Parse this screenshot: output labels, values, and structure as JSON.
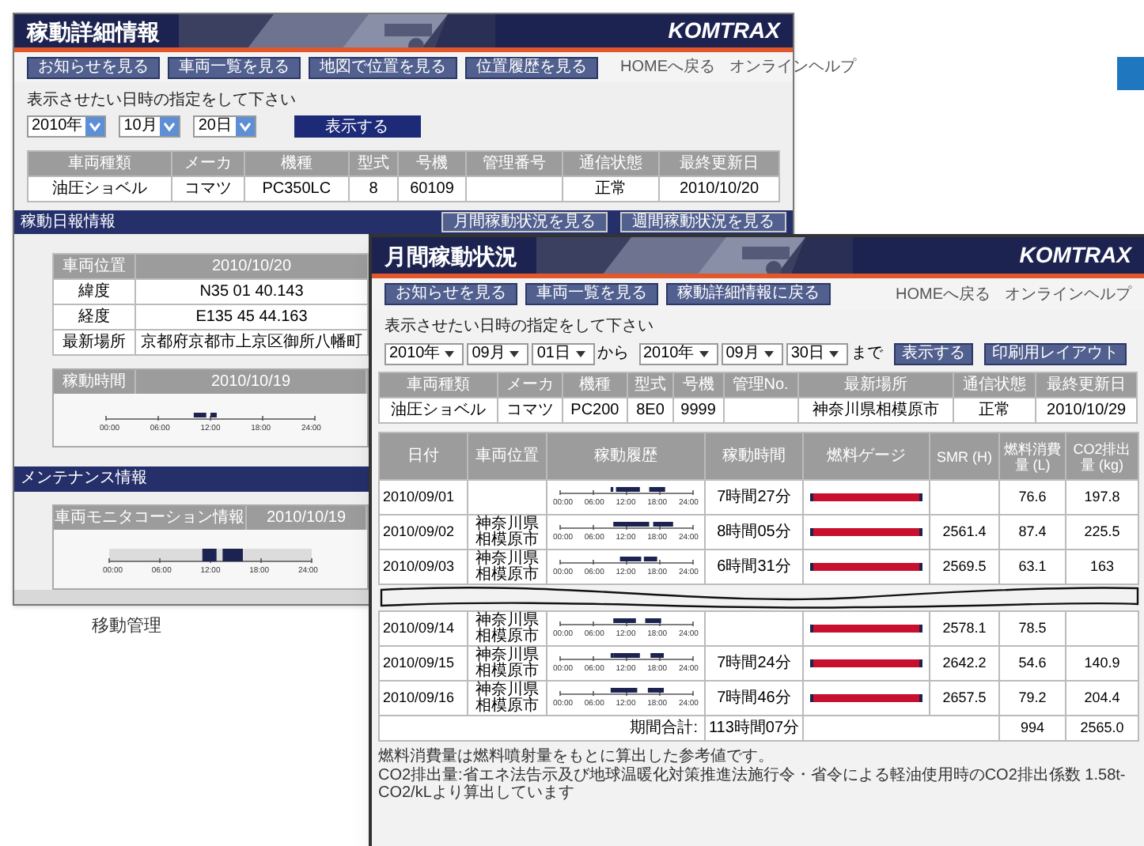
{
  "caption": "移動管理",
  "detail_window": {
    "title": "稼動詳細情報",
    "logo": "KOMTRAX",
    "nav_buttons": [
      "お知らせを見る",
      "車両一覧を見る",
      "地図で位置を見る",
      "位置履歴を見る"
    ],
    "links": [
      "HOMEへ戻る",
      "オンラインヘルプ"
    ],
    "date_prompt": "表示させたい日時の指定をして下さい",
    "selects": [
      "2010年",
      "10月",
      "20日"
    ],
    "show_button": "表示する",
    "vehicle_table": {
      "columns": [
        "車両種類",
        "メーカ",
        "機種",
        "型式",
        "号機",
        "管理番号",
        "通信状態",
        "最終更新日"
      ],
      "rows": [
        [
          "油圧ショベル",
          "コマツ",
          "PC350LC",
          "8",
          "60109",
          "",
          "正常",
          "2010/10/20"
        ]
      ]
    },
    "daily_section": {
      "title": "稼動日報情報",
      "buttons": [
        "月間稼動状況を見る",
        "週間稼動状況を見る"
      ],
      "location_table": {
        "columns": [
          "車両位置",
          "2010/10/20"
        ],
        "rows": [
          [
            "緯度",
            "N35 01 40.143"
          ],
          [
            "経度",
            "E135 45 44.163"
          ],
          [
            "最新場所",
            "京都府京都市上京区御所八幡町"
          ]
        ]
      },
      "hours_table": {
        "columns": [
          "稼動時間",
          "2010/10/19"
        ],
        "ticks": [
          "00:00",
          "06:00",
          "12:00",
          "18:00",
          "24:00"
        ]
      }
    },
    "maintenance_section": {
      "title": "メンテナンス情報",
      "columns": [
        "車両モニタコーション情報",
        "2010/10/19"
      ],
      "ticks": [
        "00:00",
        "06:00",
        "12:00",
        "18:00",
        "24:00"
      ]
    }
  },
  "monthly_window": {
    "title": "月間稼動状況",
    "logo": "KOMTRAX",
    "nav_buttons": [
      "お知らせを見る",
      "車両一覧を見る",
      "稼動詳細情報に戻る"
    ],
    "links": [
      "HOMEへ戻る",
      "オンラインヘルプ"
    ],
    "date_prompt": "表示させたい日時の指定をして下さい",
    "from_selects": [
      "2010年",
      "09月",
      "01日"
    ],
    "from_label": "から",
    "to_selects": [
      "2010年",
      "09月",
      "30日"
    ],
    "to_label": "まで",
    "buttons": [
      "表示する",
      "印刷用レイアウト"
    ],
    "vehicle_table": {
      "columns": [
        "車両種類",
        "メーカ",
        "機種",
        "型式",
        "号機",
        "管理No.",
        "最新場所",
        "通信状態",
        "最終更新日"
      ],
      "rows": [
        [
          "油圧ショベル",
          "コマツ",
          "PC200",
          "8E0",
          "9999",
          "",
          "神奈川県相模原市",
          "正常",
          "2010/10/29"
        ]
      ]
    },
    "daily_table": {
      "columns": [
        "日付",
        "車両位置",
        "稼動履歴",
        "稼動時間",
        "燃料ゲージ",
        "SMR (H)",
        "燃料消費量 (L)",
        "CO2排出量 (kg)"
      ],
      "rows": [
        {
          "date": "2010/09/01",
          "location": "",
          "ticks": [
            "00:00",
            "06:00",
            "12:00",
            "18:00",
            "24:00"
          ],
          "hours": "7時間27分",
          "fuel_gauge": {
            "level": 1
          },
          "smr": "",
          "fuel": "76.6",
          "co2": "197.8"
        },
        {
          "date": "2010/09/02",
          "location": "神奈川県相模原市",
          "ticks": [
            "00:00",
            "06:00",
            "12:00",
            "18:00",
            "24:00"
          ],
          "hours": "8時間05分",
          "fuel_gauge": {
            "level": 1
          },
          "smr": "2561.4",
          "fuel": "87.4",
          "co2": "225.5"
        },
        {
          "date": "2010/09/03",
          "location": "神奈川県相模原市",
          "ticks": [
            "00:00",
            "06:00",
            "12:00",
            "18:00",
            "24:00"
          ],
          "hours": "6時間31分",
          "fuel_gauge": {
            "level": 1
          },
          "smr": "2569.5",
          "fuel": "63.1",
          "co2": "163"
        },
        {
          "date": "2010/09/14",
          "location": "神奈川県相模原市",
          "ticks": [
            "00:00",
            "06:00",
            "12:00",
            "18:00",
            "24:00"
          ],
          "hours": "",
          "fuel_gauge": {
            "level": 1
          },
          "smr": "2578.1",
          "fuel": "78.5",
          "co2": ""
        },
        {
          "date": "2010/09/15",
          "location": "神奈川県相模原市",
          "ticks": [
            "00:00",
            "06:00",
            "12:00",
            "18:00",
            "24:00"
          ],
          "hours": "7時間24分",
          "fuel_gauge": {
            "level": 1
          },
          "smr": "2642.2",
          "fuel": "54.6",
          "co2": "140.9"
        },
        {
          "date": "2010/09/16",
          "location": "神奈川県相模原市",
          "ticks": [
            "00:00",
            "06:00",
            "12:00",
            "18:00",
            "24:00"
          ],
          "hours": "7時間46分",
          "fuel_gauge": {
            "level": 1
          },
          "smr": "2657.5",
          "fuel": "79.2",
          "co2": "204.4"
        }
      ],
      "total": {
        "label": "期間合計:",
        "hours": "113時間07分",
        "fuel": "994",
        "co2": "2565.0"
      }
    },
    "notes": [
      "燃料消費量は燃料噴射量をもとに算出した参考値です。",
      "CO2排出量:省エネ法告示及び地球温暖化対策推進法施行令・省令による軽油使用時のCO2排出係数 1.58t-CO2/kLより算出しています"
    ]
  }
}
